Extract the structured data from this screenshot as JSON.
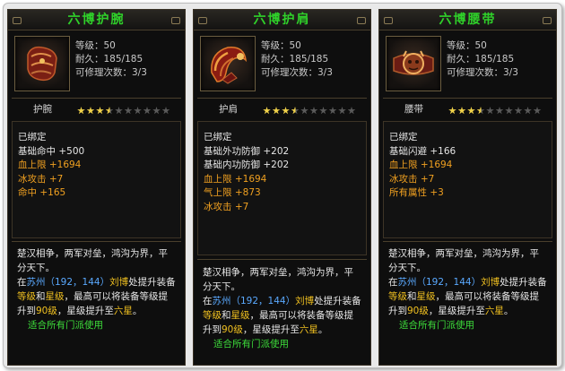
{
  "items": [
    {
      "title": "六博护腕",
      "icon": "bracer-icon",
      "level": "等级：50",
      "durability": "耐久：185/185",
      "repair": "可修理次数：3/3",
      "type": "护腕",
      "stars": 3.5,
      "bound": "已绑定",
      "base_attrs": [
        "基础命中 +500"
      ],
      "extra_attrs": [
        "血上限 +1694",
        "冰攻击 +7",
        "命中 +165"
      ]
    },
    {
      "title": "六博护肩",
      "icon": "shoulder-icon",
      "level": "等级：50",
      "durability": "耐久：185/185",
      "repair": "可修理次数：3/3",
      "type": "护肩",
      "stars": 3.5,
      "bound": "已绑定",
      "base_attrs": [
        "基础外功防御 +202",
        "基础内功防御 +202"
      ],
      "extra_attrs": [
        "血上限 +1694",
        "气上限 +873",
        "冰攻击 +7"
      ]
    },
    {
      "title": "六博腰带",
      "icon": "belt-icon",
      "level": "等级：50",
      "durability": "耐久：185/185",
      "repair": "可修理次数：3/3",
      "type": "腰带",
      "stars": 3.5,
      "bound": "已绑定",
      "base_attrs": [
        "基础闪避 +166"
      ],
      "extra_attrs": [
        "血上限 +1694",
        "冰攻击 +7",
        "所有属性 +3"
      ]
    }
  ],
  "description": {
    "line1": "楚汉相争，两军对垒，鸿沟为界，平分天下。",
    "p_at": "在",
    "place": "苏州（192，144）",
    "npc": "刘博",
    "p_mid": "处提升装备",
    "k1": "等级",
    "and": "和",
    "k2": "星级",
    "p_mid2": "，最高可以将装备等级提升到",
    "lvl": "90级",
    "p_mid3": "，星级提升至",
    "star": "六星",
    "end": "。",
    "footer": "适合所有门派使用"
  },
  "colors": {
    "title_green": "#2fd12a",
    "highlight_blue": "#5aa9ff",
    "highlight_yellow": "#f0c020",
    "extra_orange": "#f0a020",
    "star_gold": "#f1d24a"
  }
}
